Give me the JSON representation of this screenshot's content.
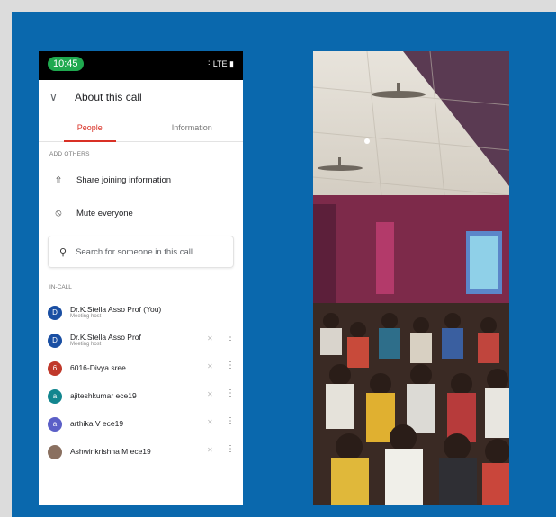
{
  "phone": {
    "status_time": "10:45",
    "status_icons": "⋮LTE ▮",
    "header": {
      "back_icon": "chevron-down-icon",
      "title": "About this call"
    },
    "tabs": [
      {
        "label": "People",
        "active": true
      },
      {
        "label": "Information",
        "active": false
      }
    ],
    "add_others_label": "ADD OTHERS",
    "actions": [
      {
        "icon": "share-icon",
        "label": "Share joining information"
      },
      {
        "icon": "mic-off-icon",
        "label": "Mute everyone"
      }
    ],
    "search_placeholder": "Search for someone in this call",
    "in_call_label": "IN-CALL",
    "participants": [
      {
        "initial": "D",
        "name": "Dr.K.Stella Asso Prof (You)",
        "role": "Meeting host",
        "color": "#1a4fa3",
        "controls": false
      },
      {
        "initial": "D",
        "name": "Dr.K.Stella Asso Prof",
        "role": "Meeting host",
        "color": "#1a4fa3",
        "controls": true
      },
      {
        "initial": "6",
        "name": "6016-Divya sree",
        "role": "",
        "color": "#c0392b",
        "controls": true
      },
      {
        "initial": "a",
        "name": "ajiteshkumar ece19",
        "role": "",
        "color": "#12868f",
        "controls": true
      },
      {
        "initial": "a",
        "name": "arthika V ece19",
        "role": "",
        "color": "#5b5fc7",
        "controls": true
      },
      {
        "initial": "",
        "name": "Ashwinkrishna M ece19",
        "role": "",
        "color": "#8a7060",
        "controls": true
      }
    ]
  },
  "colors": {
    "frame_blue": "#0a68ad",
    "tab_active": "#d93025",
    "status_green": "#1fa94f"
  }
}
